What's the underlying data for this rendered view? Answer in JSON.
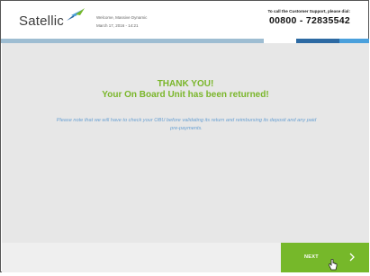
{
  "header": {
    "logo_text": "Satellic",
    "welcome_line": "Welcome, Massive Dynamic",
    "date_line": "March 17, 2016 - 14:21",
    "support_label": "To call the Customer Support, please dial:",
    "support_phone": "00800 - 72835542"
  },
  "main": {
    "thanks_line1": "THANK YOU!",
    "thanks_line2": "Your On Board Unit has been returned!",
    "note": "Please note that we will have to check your OBU before validating its return and reimbursing its deposit and any paid pre-payments."
  },
  "footer": {
    "next_label": "NEXT"
  },
  "colors": {
    "accent_green": "#76b82a",
    "note_blue": "#6aa1d3",
    "stripe_dark_blue": "#2d6aa3",
    "stripe_light_blue": "#4aa0dc"
  },
  "icons": [
    "satellic-logo-icon",
    "chevron-right-icon",
    "hand-cursor-icon"
  ]
}
